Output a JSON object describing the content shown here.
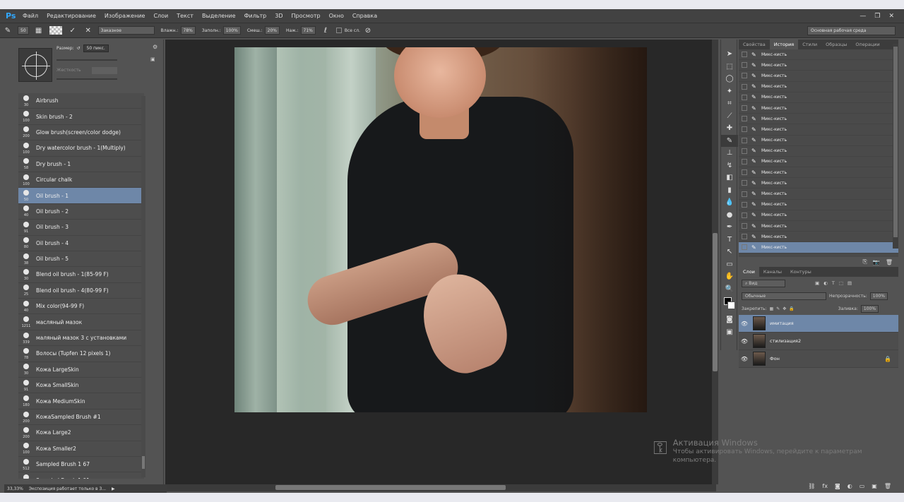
{
  "app": {
    "logo": "Ps"
  },
  "window_buttons": [
    "—",
    "❐",
    "✕"
  ],
  "menu": [
    "Файл",
    "Редактирование",
    "Изображение",
    "Слои",
    "Текст",
    "Выделение",
    "Фильтр",
    "3D",
    "Просмотр",
    "Окно",
    "Справка"
  ],
  "options": {
    "brush_size": "50",
    "mode": "Заказное",
    "wet_label": "Влажн.:",
    "wet": "78%",
    "load_label": "Заполн.:",
    "load": "100%",
    "mix_label": "Смеш.:",
    "mix": "20%",
    "flow_label": "Наж.:",
    "flow": "71%",
    "sample_all": "Все сл.",
    "workspace": "Основная рабочая среда"
  },
  "brush_panel": {
    "size_label": "Размер:",
    "size_value": "50 пикс.",
    "hardness_label": "Жесткость",
    "brushes": [
      {
        "size": "30",
        "name": "Airbrush"
      },
      {
        "size": "100",
        "name": "Skin brush - 2"
      },
      {
        "size": "200",
        "name": "Glow brush(screen/color dodge)"
      },
      {
        "size": "100",
        "name": "Dry watercolor brush - 1(Multiply)"
      },
      {
        "size": "58",
        "name": "Dry brush - 1"
      },
      {
        "size": "100",
        "name": "Circular chalk"
      },
      {
        "size": "50",
        "name": "Oil brush - 1"
      },
      {
        "size": "40",
        "name": "Oil brush - 2"
      },
      {
        "size": "91",
        "name": "Oil brush - 3"
      },
      {
        "size": "80",
        "name": "Oil brush - 4"
      },
      {
        "size": "38",
        "name": "Oil brush - 5"
      },
      {
        "size": "30",
        "name": "Blend oil brush - 1(85-99 F)"
      },
      {
        "size": "25",
        "name": "Blend oil brush - 4(80-99 F)"
      },
      {
        "size": "40",
        "name": "Mix color(94-99 F)"
      },
      {
        "size": "1211",
        "name": "масляный мазок"
      },
      {
        "size": "339",
        "name": "маляный мазок 3 с установками"
      },
      {
        "size": "78",
        "name": "Волосы (Tupfen 12 pixels 1)"
      },
      {
        "size": "30",
        "name": "Кожа LargeSkin"
      },
      {
        "size": "91",
        "name": "Кожа SmallSkin"
      },
      {
        "size": "180",
        "name": "Кожа MediumSkin"
      },
      {
        "size": "200",
        "name": "КожаSampled Brush #1"
      },
      {
        "size": "200",
        "name": "Кожа Large2"
      },
      {
        "size": "100",
        "name": "Кожа Smaller2"
      },
      {
        "size": "512",
        "name": "Sampled Brush 1 67"
      },
      {
        "size": "",
        "name": "Sampled Brush 1 91"
      }
    ],
    "selected_index": 6
  },
  "status": {
    "zoom": "33,33%",
    "text": "Экспозиция работает только в 3..."
  },
  "panels": {
    "top_tabs": [
      "Свойства",
      "История",
      "Стили",
      "Образцы",
      "Операции"
    ],
    "history_item": "Микс-кисть",
    "layer_tabs": [
      "Слои",
      "Каналы",
      "Контуры"
    ],
    "filter_label": "Вид",
    "blend_mode": "Обычные",
    "opacity_label": "Непрозрачность:",
    "opacity": "100%",
    "lock_label": "Закрепить:",
    "fill_label": "Заливка:",
    "fill": "100%",
    "layers": [
      "имитация",
      "стилизация2",
      "Фон"
    ]
  },
  "watermark": {
    "title": "Активация Windows",
    "subtitle": "Чтобы активировать Windows, перейдите к параметрам компьютера."
  }
}
